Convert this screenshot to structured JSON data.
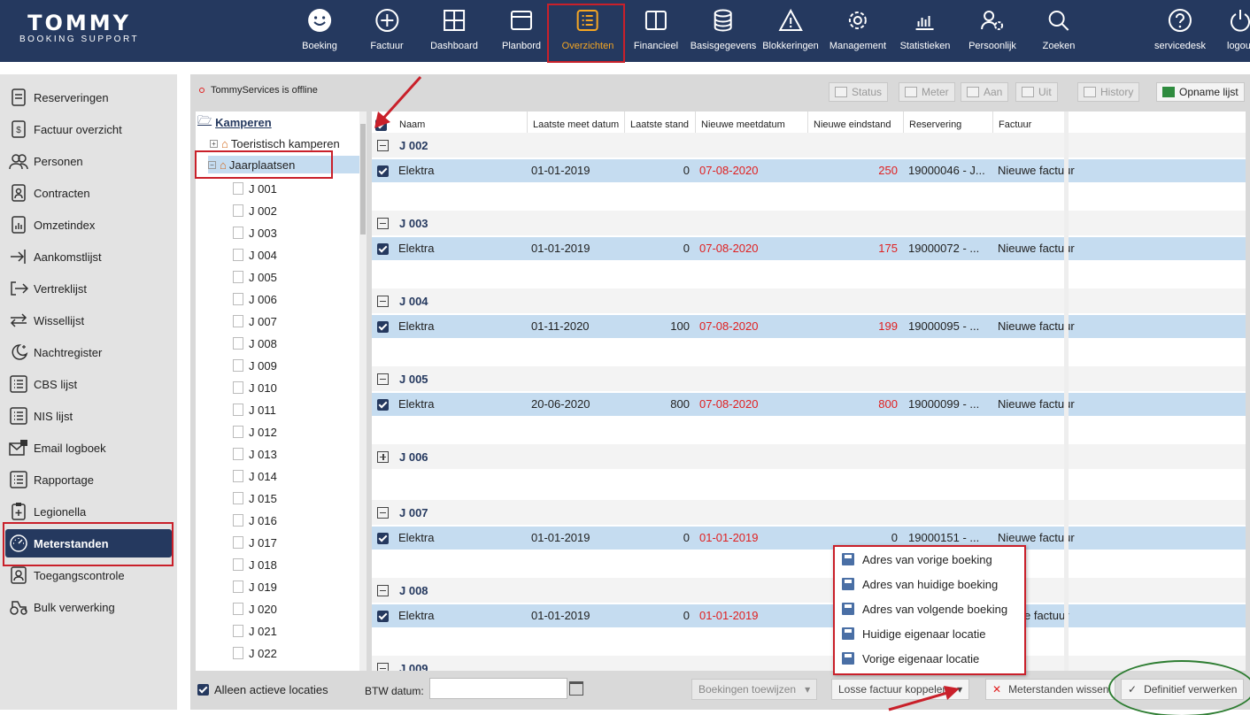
{
  "brand": {
    "name": "TOMMY",
    "subtitle": "BOOKING SUPPORT"
  },
  "nav": [
    {
      "label": "Boeking",
      "icon": "smiley-icon"
    },
    {
      "label": "Factuur",
      "icon": "plus-circle-icon"
    },
    {
      "label": "Dashboard",
      "icon": "dashboard-grid-icon"
    },
    {
      "label": "Planbord",
      "icon": "planbord-icon"
    },
    {
      "label": "Overzichten",
      "icon": "list-icon",
      "active": true
    },
    {
      "label": "Financieel",
      "icon": "book-icon"
    },
    {
      "label": "Basisgegevens",
      "icon": "database-icon"
    },
    {
      "label": "Blokkeringen",
      "icon": "warning-icon"
    },
    {
      "label": "Management",
      "icon": "gear-icon"
    },
    {
      "label": "Statistieken",
      "icon": "bar-chart-icon"
    },
    {
      "label": "Persoonlijk",
      "icon": "user-gear-icon"
    },
    {
      "label": "Zoeken",
      "icon": "search-icon"
    },
    {
      "label": "servicedesk",
      "icon": "help-icon"
    },
    {
      "label": "logout",
      "icon": "power-icon"
    }
  ],
  "sidebar": [
    {
      "label": "Reserveringen",
      "icon": "document-icon"
    },
    {
      "label": "Factuur overzicht",
      "icon": "invoice-icon"
    },
    {
      "label": "Personen",
      "icon": "people-icon"
    },
    {
      "label": "Contracten",
      "icon": "contract-icon"
    },
    {
      "label": "Omzetindex",
      "icon": "chart-doc-icon"
    },
    {
      "label": "Aankomstlijst",
      "icon": "arrive-icon"
    },
    {
      "label": "Vertreklijst",
      "icon": "depart-icon"
    },
    {
      "label": "Wissellijst",
      "icon": "swap-icon"
    },
    {
      "label": "Nachtregister",
      "icon": "moon-icon"
    },
    {
      "label": "CBS lijst",
      "icon": "list-box-icon"
    },
    {
      "label": "NIS lijst",
      "icon": "list-box-icon"
    },
    {
      "label": "Email logboek",
      "icon": "mail-icon"
    },
    {
      "label": "Rapportage",
      "icon": "list-box-icon"
    },
    {
      "label": "Legionella",
      "icon": "clipboard-plus-icon"
    },
    {
      "label": "Meterstanden",
      "icon": "gauge-icon",
      "active": true
    },
    {
      "label": "Toegangscontrole",
      "icon": "access-icon"
    },
    {
      "label": "Bulk verwerking",
      "icon": "tractor-icon"
    }
  ],
  "status": "TommyServices is offline",
  "toolbar": {
    "status": "Status",
    "meter": "Meter",
    "aan": "Aan",
    "uit": "Uit",
    "history": "History",
    "opname": "Opname lijst"
  },
  "tree": {
    "root": "Kamperen",
    "toeristisch": "Toeristisch kamperen",
    "jaarplaatsen": "Jaarplaatsen",
    "items": [
      "J 001",
      "J 002",
      "J 003",
      "J 004",
      "J 005",
      "J 006",
      "J 007",
      "J 008",
      "J 009",
      "J 010",
      "J 011",
      "J 012",
      "J 013",
      "J 014",
      "J 015",
      "J 016",
      "J 017",
      "J 018",
      "J 019",
      "J 020",
      "J 021",
      "J 022"
    ]
  },
  "columns": {
    "naam": "Naam",
    "laatste_datum": "Laatste meet datum",
    "laatste_stand": "Laatste stand",
    "nieuwe_datum": "Nieuwe meetdatum",
    "nieuwe_stand": "Nieuwe eindstand",
    "reservering": "Reservering",
    "factuur": "Factuur"
  },
  "groups": [
    {
      "label": "J 002",
      "row": {
        "naam": "Elektra",
        "laatste_datum": "01-01-2019",
        "laatste_stand": "0",
        "nieuwe_datum": "07-08-2020",
        "nieuwe_stand": "250",
        "reservering": "19000046 - J...",
        "factuur": "Nieuwe factuur"
      }
    },
    {
      "label": "J 003",
      "row": {
        "naam": "Elektra",
        "laatste_datum": "01-01-2019",
        "laatste_stand": "0",
        "nieuwe_datum": "07-08-2020",
        "nieuwe_stand": "175",
        "reservering": "19000072 - ...",
        "factuur": "Nieuwe factuur"
      }
    },
    {
      "label": "J 004",
      "row": {
        "naam": "Elektra",
        "laatste_datum": "01-11-2020",
        "laatste_stand": "100",
        "nieuwe_datum": "07-08-2020",
        "nieuwe_stand": "199",
        "reservering": "19000095 - ...",
        "factuur": "Nieuwe factuur"
      }
    },
    {
      "label": "J 005",
      "row": {
        "naam": "Elektra",
        "laatste_datum": "20-06-2020",
        "laatste_stand": "800",
        "nieuwe_datum": "07-08-2020",
        "nieuwe_stand": "800",
        "reservering": "19000099 - ...",
        "factuur": "Nieuwe factuur"
      }
    },
    {
      "label": "J 006",
      "collapsed": true
    },
    {
      "label": "J 007",
      "row": {
        "naam": "Elektra",
        "laatste_datum": "01-01-2019",
        "laatste_stand": "0",
        "nieuwe_datum": "01-01-2019",
        "nieuwe_stand": "0",
        "reservering": "19000151 - ...",
        "factuur": "Nieuwe factuur"
      }
    },
    {
      "label": "J 008",
      "row": {
        "naam": "Elektra",
        "laatste_datum": "01-01-2019",
        "laatste_stand": "0",
        "nieuwe_datum": "01-01-2019",
        "factuur": "e factuur"
      }
    },
    {
      "label": "J 009"
    }
  ],
  "bottom": {
    "alleen_actief": "Alleen actieve locaties",
    "btw_datum": "BTW datum:",
    "boekingen": "Boekingen toewijzen",
    "losse": "Losse factuur koppelen",
    "wissen": "Meterstanden wissen",
    "definitief": "Definitief verwerken"
  },
  "context_menu": [
    "Adres van vorige boeking",
    "Adres van huidige boeking",
    "Adres van volgende boeking",
    "Huidige eigenaar locatie",
    "Vorige eigenaar locatie"
  ],
  "colors": {
    "navy": "#25395f",
    "accent": "#f5a623",
    "highlight": "#c9202a",
    "row": "#c5dcf0",
    "value_red": "#e02020",
    "circle": "#2e7d32"
  }
}
